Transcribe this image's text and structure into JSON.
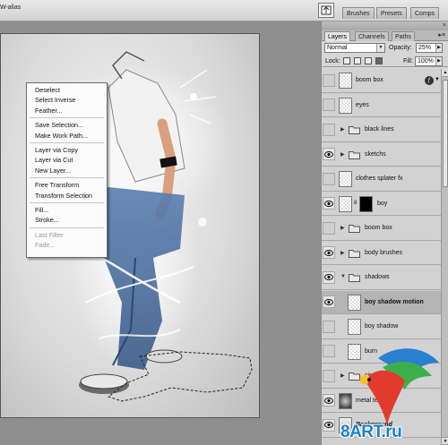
{
  "optionsbar": {
    "antialias_label": "W-alias"
  },
  "panel_well": {
    "tabs": [
      "Brushes",
      "Presets",
      "Comps"
    ]
  },
  "context_menu": {
    "groups": [
      [
        "Deselect",
        "Select Inverse",
        "Feather..."
      ],
      [
        "Save Selection...",
        "Make Work Path..."
      ],
      [
        "Layer via Copy",
        "Layer via Cut",
        "New Layer..."
      ],
      [
        "Free Transform",
        "Transform Selection"
      ],
      [
        "Fill...",
        "Stroke..."
      ],
      [
        "Last Filter",
        "Fade..."
      ]
    ],
    "disabled": [
      "Last Filter",
      "Fade..."
    ]
  },
  "layers_panel": {
    "tabs": [
      "Layers",
      "Channels",
      "Paths"
    ],
    "active_tab": "Layers",
    "blend_mode": "Normal",
    "opacity_label": "Opacity:",
    "opacity": "25%",
    "lock_label": "Lock:",
    "fill_label": "Fill:",
    "fill": "100%",
    "layers": [
      {
        "name": "boom box",
        "visible": false,
        "kind": "layer",
        "fx": true
      },
      {
        "name": "eyes",
        "visible": false,
        "kind": "layer"
      },
      {
        "name": "black lines",
        "visible": false,
        "kind": "group"
      },
      {
        "name": "sketchs",
        "visible": true,
        "kind": "group"
      },
      {
        "name": "clothes splater fx",
        "visible": false,
        "kind": "layer"
      },
      {
        "name": "boy",
        "visible": true,
        "kind": "masked"
      },
      {
        "name": "boom box",
        "visible": false,
        "kind": "group"
      },
      {
        "name": "body brushes",
        "visible": true,
        "kind": "group"
      },
      {
        "name": "shadows",
        "visible": true,
        "kind": "group-open"
      },
      {
        "name": "boy shadow motion",
        "visible": true,
        "kind": "child",
        "selected": true
      },
      {
        "name": "boy shadow",
        "visible": false,
        "kind": "child"
      },
      {
        "name": "burn",
        "visible": false,
        "kind": "child"
      },
      {
        "name": "circles",
        "visible": false,
        "kind": "group"
      },
      {
        "name": "metal texture",
        "visible": true,
        "kind": "dark"
      },
      {
        "name": "Background",
        "visible": true,
        "kind": "bg"
      }
    ]
  },
  "watermark": {
    "text": "8ART.ru"
  }
}
